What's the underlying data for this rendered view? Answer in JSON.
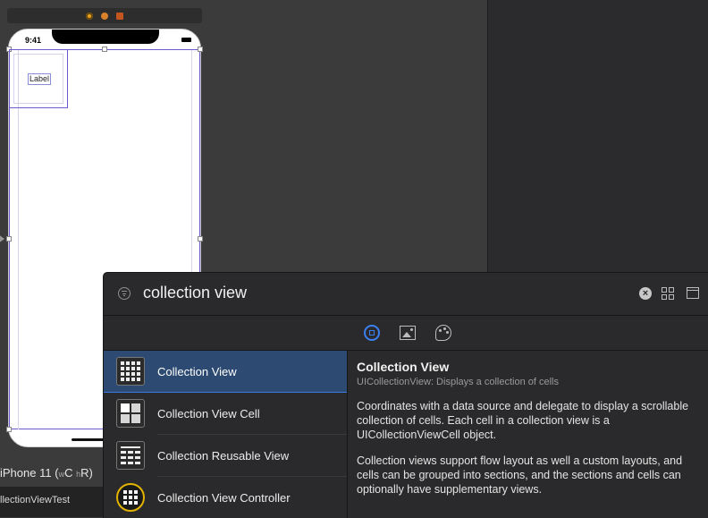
{
  "canvas": {
    "status_time": "9:41",
    "cell_label": "Label",
    "device_label": "iPhone 11",
    "size_class_open": "(",
    "size_class_w": "w",
    "size_class_c": "C",
    "size_class_h": "h",
    "size_class_close": "R)",
    "document_name": "llectionViewTest"
  },
  "library": {
    "search_query": "collection view",
    "tabs": [
      {
        "name": "objects",
        "icon": "square-in-circle-icon",
        "active": true
      },
      {
        "name": "media",
        "icon": "image-icon",
        "active": false
      },
      {
        "name": "colors",
        "icon": "palette-icon",
        "active": false
      }
    ],
    "items": [
      {
        "label": "Collection View",
        "icon": "collection-view-icon",
        "selected": true
      },
      {
        "label": "Collection View Cell",
        "icon": "collection-view-cell-icon",
        "selected": false
      },
      {
        "label": "Collection Reusable View",
        "icon": "collection-reusable-view-icon",
        "selected": false
      },
      {
        "label": "Collection View Controller",
        "icon": "collection-view-controller-icon",
        "selected": false
      }
    ],
    "detail": {
      "title": "Collection View",
      "subtitle": "UICollectionView: Displays a collection of cells",
      "paragraph1": "Coordinates with a data source and delegate to display a scrollable collection of cells. Each cell in a collection view is a UICollectionViewCell object.",
      "paragraph2": "Collection views support flow layout as well a custom layouts, and cells can be grouped into sections, and the sections and cells can optionally have supplementary views."
    }
  },
  "colors": {
    "selection_accent": "#3b7ad8",
    "controller_icon_ring": "#e2b300",
    "view_outline": "#6a5acd"
  }
}
